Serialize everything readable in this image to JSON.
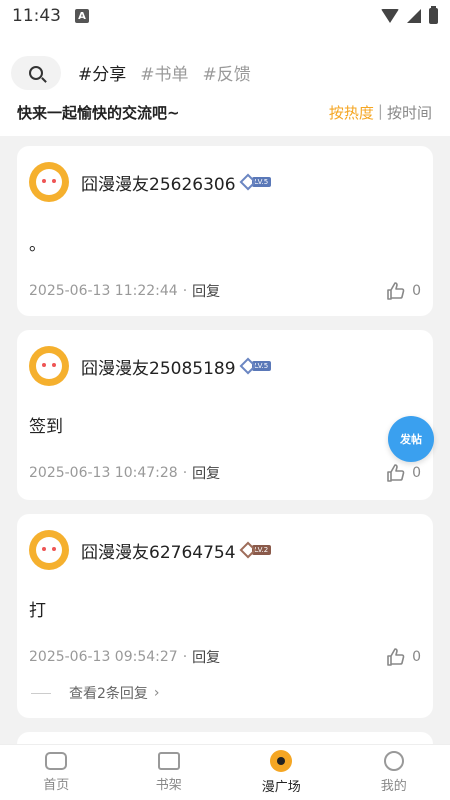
{
  "status_bar": {
    "time": "11:43",
    "notification_icon": "A"
  },
  "header": {
    "tags": [
      "#分享",
      "#书单",
      "#反馈"
    ],
    "subtitle": "快来一起愉快的交流吧~",
    "sort_hot": "按热度",
    "sort_separator": "|",
    "sort_time": "按时间"
  },
  "posts": [
    {
      "username": "囧漫漫友25626306",
      "level": "LV.5",
      "content": "。",
      "time": "2025-06-13 11:22:44",
      "reply": "回复",
      "likes": "0"
    },
    {
      "username": "囧漫漫友25085189",
      "level": "LV.5",
      "content": "签到",
      "time": "2025-06-13 10:47:28",
      "reply": "回复",
      "likes": "0"
    },
    {
      "username": "囧漫漫友62764754",
      "level": "LV.2",
      "content": "打",
      "time": "2025-06-13 09:54:27",
      "reply": "回复",
      "likes": "0",
      "more_replies": "查看2条回复"
    }
  ],
  "fab_label": "发帖",
  "nav": [
    {
      "label": "首页"
    },
    {
      "label": "书架"
    },
    {
      "label": "漫广场"
    },
    {
      "label": "我的"
    }
  ],
  "colors": {
    "accent": "#f5a623",
    "fab": "#3aa0ef"
  }
}
